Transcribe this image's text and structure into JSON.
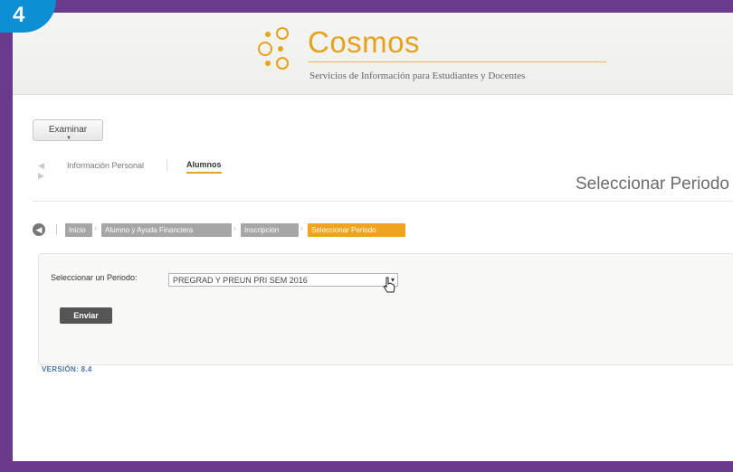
{
  "badge": "4",
  "brand": {
    "title": "Cosmos",
    "subtitle": "Servicios de Información para Estudiantes y Docentes",
    "accent": "#e6a21c"
  },
  "toolbar": {
    "explore_label": "Examinar"
  },
  "tabs": [
    {
      "label": "Información Personal"
    },
    {
      "label": "Alumnos"
    }
  ],
  "page_title": "Seleccionar Periodo",
  "breadcrumb": [
    {
      "label": "Inicio"
    },
    {
      "label": "Alumno y Ayuda Financiera"
    },
    {
      "label": "Inscripción"
    },
    {
      "label": "Seleccionar Periodo"
    }
  ],
  "form": {
    "select_label": "Seleccionar un Periodo:",
    "select_value": "PREGRAD Y PREUN PRI SEM 2016",
    "submit_label": "Enviar"
  },
  "version": "VERSIÓN: 8.4",
  "colors": {
    "frame": "#6a3a8c",
    "badge": "#0c8fd3",
    "active_crumb": "#f0a31e",
    "inactive_crumb": "#a6a6a6"
  }
}
